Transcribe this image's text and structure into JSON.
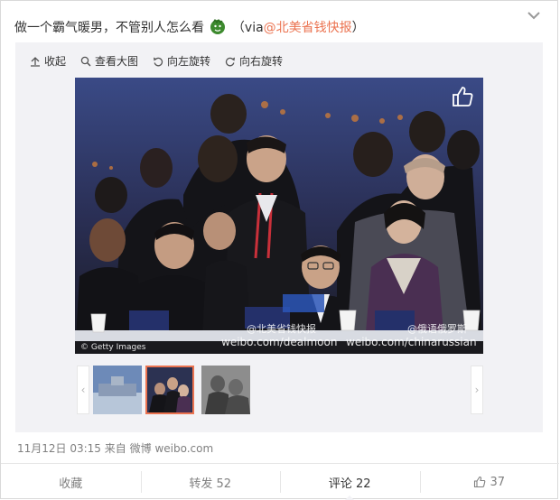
{
  "post": {
    "text": "做一个霸气暖男，不管别人怎么看",
    "via_open": "（via",
    "via_link": "@北美省钱快报",
    "via_close": "）"
  },
  "toolbar": {
    "collapse": "收起",
    "view_large": "查看大图",
    "rotate_left": "向左旋转",
    "rotate_right": "向右旋转"
  },
  "photo": {
    "watermark_handle1": "@北美省钱快报",
    "watermark_handle2": "@俄语俄罗斯",
    "watermark_url1": "weibo.com/dealmoon",
    "watermark_url2": "weibo.com/chinarussian",
    "credit": "© Getty Images"
  },
  "meta": {
    "date": "11月12日 03:15",
    "source_prefix": "来自",
    "source_app": "微博",
    "source_domain": "weibo.com"
  },
  "actions": {
    "favorite": "收藏",
    "repost": "转发 52",
    "comment": "评论 22",
    "like_count": "37"
  },
  "colors": {
    "link": "#eb7350",
    "panel_bg": "#f2f2f5",
    "muted_text": "#808080"
  }
}
